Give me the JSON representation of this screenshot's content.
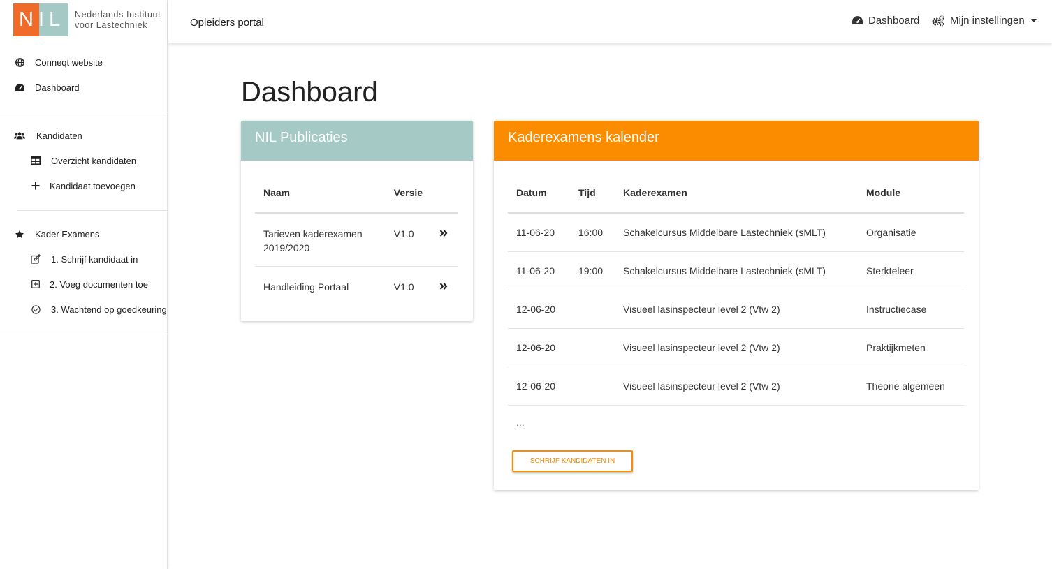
{
  "brand": {
    "logo_letters": "NIL",
    "name_line1": "Nederlands Instituut",
    "name_line2": "voor Lastechniek",
    "color_orange": "#f06a2a",
    "color_teal": "#a5c9c4"
  },
  "sidebar": {
    "top_items": [
      {
        "label": "Conneqt website",
        "icon": "globe-icon"
      },
      {
        "label": "Dashboard",
        "icon": "tachometer-icon"
      }
    ],
    "kandidaten": {
      "label": "Kandidaten",
      "icon": "users-icon",
      "children": [
        {
          "label": "Overzicht kandidaten",
          "icon": "table-icon"
        },
        {
          "label": "Kandidaat toevoegen",
          "icon": "plus-icon"
        }
      ]
    },
    "kader_examens": {
      "label": "Kader Examens",
      "icon": "star-icon",
      "children": [
        {
          "label": "1. Schrijf kandidaat in",
          "icon": "edit-icon"
        },
        {
          "label": "2. Voeg documenten toe",
          "icon": "plus-square-icon"
        },
        {
          "label": "3. Wachtend op goedkeuring",
          "icon": "check-circle-icon"
        }
      ]
    }
  },
  "topbar": {
    "title": "Opleiders portal",
    "dashboard_link": "Dashboard",
    "settings_link": "Mijn instellingen"
  },
  "main": {
    "page_title": "Dashboard"
  },
  "publicaties": {
    "header": "NIL Publicaties",
    "columns": {
      "naam": "Naam",
      "versie": "Versie"
    },
    "rows": [
      {
        "naam": "Tarieven kaderexamen 2019/2020",
        "versie": "V1.0"
      },
      {
        "naam": "Handleiding Portaal",
        "versie": "V1.0"
      }
    ]
  },
  "kalender": {
    "header": "Kaderexamens kalender",
    "columns": {
      "datum": "Datum",
      "tijd": "Tijd",
      "kaderexamen": "Kaderexamen",
      "module": "Module"
    },
    "rows": [
      {
        "datum": "11-06-20",
        "tijd": "16:00",
        "kaderexamen": "Schakelcursus Middelbare Lastechniek (sMLT)",
        "module": "Organisatie"
      },
      {
        "datum": "11-06-20",
        "tijd": "19:00",
        "kaderexamen": "Schakelcursus Middelbare Lastechniek (sMLT)",
        "module": "Sterkteleer"
      },
      {
        "datum": "12-06-20",
        "tijd": "",
        "kaderexamen": "Visueel lasinspecteur level 2 (Vtw 2)",
        "module": "Instructiecase"
      },
      {
        "datum": "12-06-20",
        "tijd": "",
        "kaderexamen": "Visueel lasinspecteur level 2 (Vtw 2)",
        "module": "Praktijkmeten"
      },
      {
        "datum": "12-06-20",
        "tijd": "",
        "kaderexamen": "Visueel lasinspecteur level 2 (Vtw 2)",
        "module": "Theorie algemeen"
      }
    ],
    "more": "...",
    "button": "SCHRIJF KANDIDATEN IN"
  },
  "accent_orange": "#fb8c00"
}
